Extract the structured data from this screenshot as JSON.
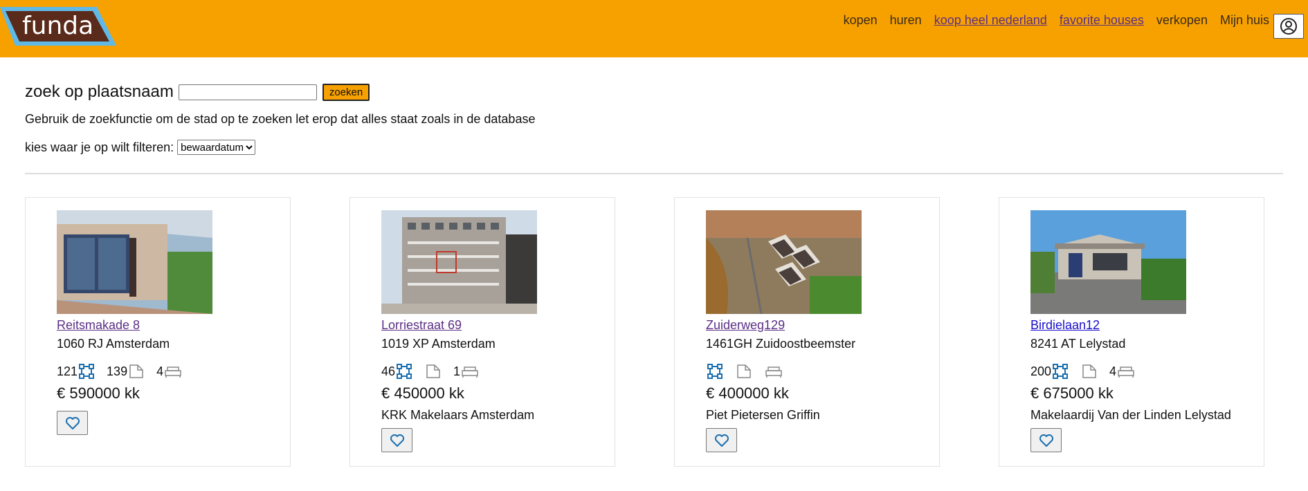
{
  "header": {
    "logo_text": "funda",
    "nav": [
      {
        "label": "kopen",
        "underlined": false
      },
      {
        "label": "huren",
        "underlined": false
      },
      {
        "label": "koop heel nederland",
        "underlined": true
      },
      {
        "label": "favorite houses",
        "underlined": true
      },
      {
        "label": "verkopen",
        "underlined": false
      },
      {
        "label": "Mijn huis",
        "underlined": false
      }
    ],
    "account_icon": "user-circle-icon",
    "brand_color": "#f7a100"
  },
  "search": {
    "label": "zoek op plaatsnaam",
    "input_value": "",
    "button_label": "zoeken",
    "help_text": "Gebruik de zoekfunctie om de stad op te zoeken let erop dat alles staat zoals in de database",
    "filter_label": "kies waar je op wilt filteren:",
    "filter_selected": "bewaardatum"
  },
  "listings": [
    {
      "title": "Reitsmakade 8",
      "city": "1060 RJ Amsterdam",
      "living_area": "121",
      "plot_area": "139",
      "bedrooms": "4",
      "price": "€ 590000 kk",
      "agent": ""
    },
    {
      "title": "Lorriestraat 69",
      "city": "1019 XP Amsterdam",
      "living_area": "46",
      "plot_area": "",
      "bedrooms": "1",
      "price": "€ 450000 kk",
      "agent": "KRK Makelaars Amsterdam"
    },
    {
      "title": "Zuiderweg129",
      "city": "1461GH Zuidoostbeemster",
      "living_area": "",
      "plot_area": "",
      "bedrooms": "",
      "price": "€ 400000 kk",
      "agent": "Piet Pietersen Griffin"
    },
    {
      "title": "Birdielaan12",
      "city": "8241 AT Lelystad",
      "living_area": "200",
      "plot_area": "",
      "bedrooms": "4",
      "price": "€ 675000 kk",
      "agent": "Makelaardij Van der Linden Lelystad"
    }
  ]
}
